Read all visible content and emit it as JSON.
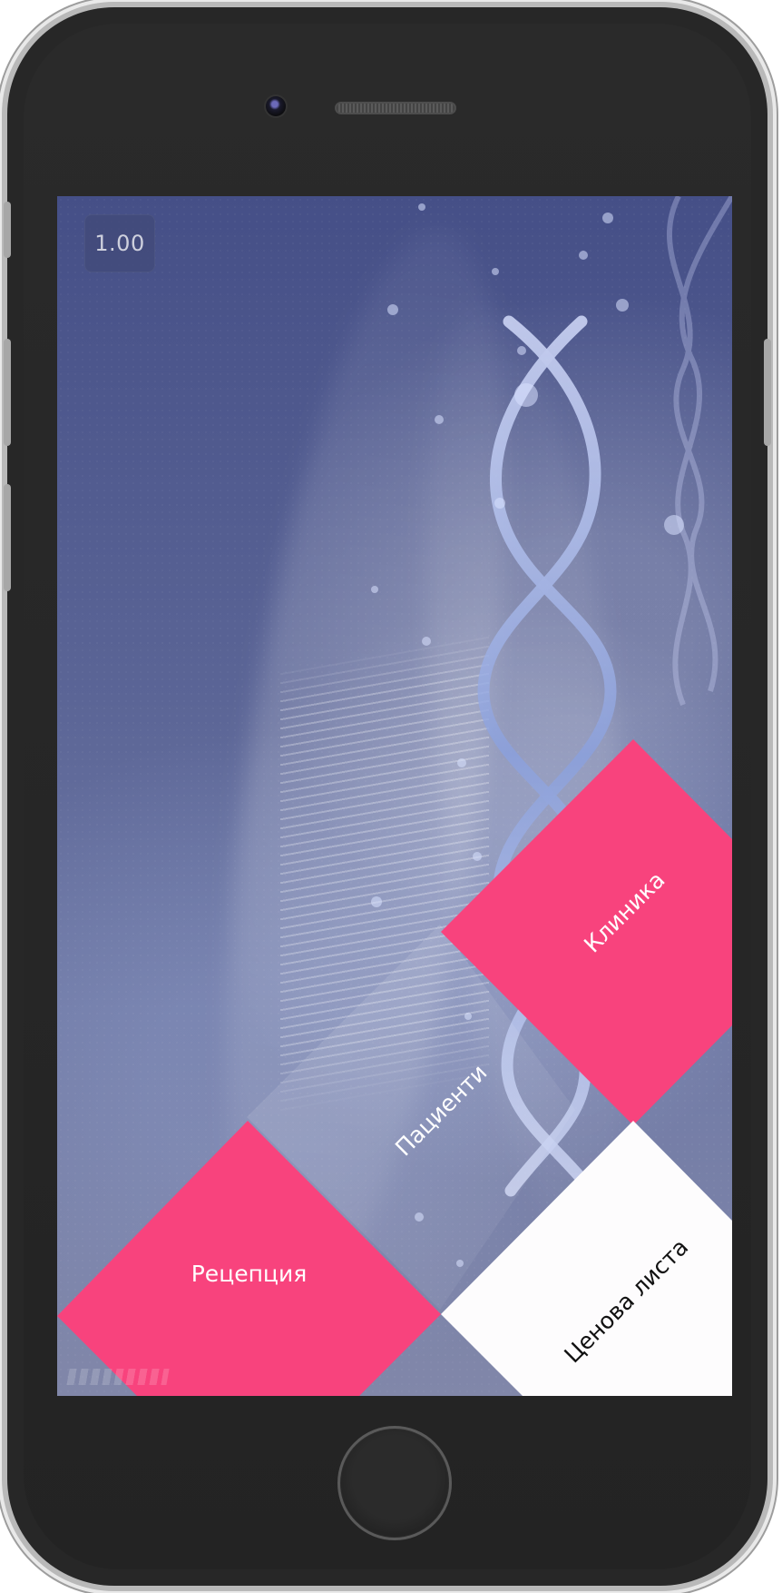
{
  "app": {
    "version": "1.00"
  },
  "menu": {
    "reception": "Рецепция",
    "patients": "Пациенти",
    "clinic": "Клиника",
    "price_list": "Ценова листа"
  },
  "icons": {
    "camera": "front-camera-icon",
    "speaker": "speaker-grille-icon",
    "home": "home-button-icon",
    "dna": "dna-helix-icon"
  },
  "colors": {
    "accent": "#f8437d",
    "background": "#5b6596",
    "light_tile": "#fdfcfd",
    "phone_body": "#272727"
  }
}
